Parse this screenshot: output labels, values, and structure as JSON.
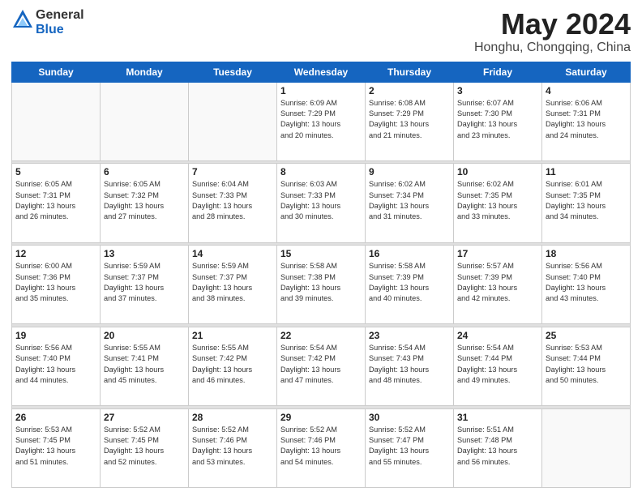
{
  "header": {
    "logo_general": "General",
    "logo_blue": "Blue",
    "title": "May 2024",
    "location": "Honghu, Chongqing, China"
  },
  "days_of_week": [
    "Sunday",
    "Monday",
    "Tuesday",
    "Wednesday",
    "Thursday",
    "Friday",
    "Saturday"
  ],
  "weeks": [
    [
      {
        "day": "",
        "info": ""
      },
      {
        "day": "",
        "info": ""
      },
      {
        "day": "",
        "info": ""
      },
      {
        "day": "1",
        "info": "Sunrise: 6:09 AM\nSunset: 7:29 PM\nDaylight: 13 hours\nand 20 minutes."
      },
      {
        "day": "2",
        "info": "Sunrise: 6:08 AM\nSunset: 7:29 PM\nDaylight: 13 hours\nand 21 minutes."
      },
      {
        "day": "3",
        "info": "Sunrise: 6:07 AM\nSunset: 7:30 PM\nDaylight: 13 hours\nand 23 minutes."
      },
      {
        "day": "4",
        "info": "Sunrise: 6:06 AM\nSunset: 7:31 PM\nDaylight: 13 hours\nand 24 minutes."
      }
    ],
    [
      {
        "day": "5",
        "info": "Sunrise: 6:05 AM\nSunset: 7:31 PM\nDaylight: 13 hours\nand 26 minutes."
      },
      {
        "day": "6",
        "info": "Sunrise: 6:05 AM\nSunset: 7:32 PM\nDaylight: 13 hours\nand 27 minutes."
      },
      {
        "day": "7",
        "info": "Sunrise: 6:04 AM\nSunset: 7:33 PM\nDaylight: 13 hours\nand 28 minutes."
      },
      {
        "day": "8",
        "info": "Sunrise: 6:03 AM\nSunset: 7:33 PM\nDaylight: 13 hours\nand 30 minutes."
      },
      {
        "day": "9",
        "info": "Sunrise: 6:02 AM\nSunset: 7:34 PM\nDaylight: 13 hours\nand 31 minutes."
      },
      {
        "day": "10",
        "info": "Sunrise: 6:02 AM\nSunset: 7:35 PM\nDaylight: 13 hours\nand 33 minutes."
      },
      {
        "day": "11",
        "info": "Sunrise: 6:01 AM\nSunset: 7:35 PM\nDaylight: 13 hours\nand 34 minutes."
      }
    ],
    [
      {
        "day": "12",
        "info": "Sunrise: 6:00 AM\nSunset: 7:36 PM\nDaylight: 13 hours\nand 35 minutes."
      },
      {
        "day": "13",
        "info": "Sunrise: 5:59 AM\nSunset: 7:37 PM\nDaylight: 13 hours\nand 37 minutes."
      },
      {
        "day": "14",
        "info": "Sunrise: 5:59 AM\nSunset: 7:37 PM\nDaylight: 13 hours\nand 38 minutes."
      },
      {
        "day": "15",
        "info": "Sunrise: 5:58 AM\nSunset: 7:38 PM\nDaylight: 13 hours\nand 39 minutes."
      },
      {
        "day": "16",
        "info": "Sunrise: 5:58 AM\nSunset: 7:39 PM\nDaylight: 13 hours\nand 40 minutes."
      },
      {
        "day": "17",
        "info": "Sunrise: 5:57 AM\nSunset: 7:39 PM\nDaylight: 13 hours\nand 42 minutes."
      },
      {
        "day": "18",
        "info": "Sunrise: 5:56 AM\nSunset: 7:40 PM\nDaylight: 13 hours\nand 43 minutes."
      }
    ],
    [
      {
        "day": "19",
        "info": "Sunrise: 5:56 AM\nSunset: 7:40 PM\nDaylight: 13 hours\nand 44 minutes."
      },
      {
        "day": "20",
        "info": "Sunrise: 5:55 AM\nSunset: 7:41 PM\nDaylight: 13 hours\nand 45 minutes."
      },
      {
        "day": "21",
        "info": "Sunrise: 5:55 AM\nSunset: 7:42 PM\nDaylight: 13 hours\nand 46 minutes."
      },
      {
        "day": "22",
        "info": "Sunrise: 5:54 AM\nSunset: 7:42 PM\nDaylight: 13 hours\nand 47 minutes."
      },
      {
        "day": "23",
        "info": "Sunrise: 5:54 AM\nSunset: 7:43 PM\nDaylight: 13 hours\nand 48 minutes."
      },
      {
        "day": "24",
        "info": "Sunrise: 5:54 AM\nSunset: 7:44 PM\nDaylight: 13 hours\nand 49 minutes."
      },
      {
        "day": "25",
        "info": "Sunrise: 5:53 AM\nSunset: 7:44 PM\nDaylight: 13 hours\nand 50 minutes."
      }
    ],
    [
      {
        "day": "26",
        "info": "Sunrise: 5:53 AM\nSunset: 7:45 PM\nDaylight: 13 hours\nand 51 minutes."
      },
      {
        "day": "27",
        "info": "Sunrise: 5:52 AM\nSunset: 7:45 PM\nDaylight: 13 hours\nand 52 minutes."
      },
      {
        "day": "28",
        "info": "Sunrise: 5:52 AM\nSunset: 7:46 PM\nDaylight: 13 hours\nand 53 minutes."
      },
      {
        "day": "29",
        "info": "Sunrise: 5:52 AM\nSunset: 7:46 PM\nDaylight: 13 hours\nand 54 minutes."
      },
      {
        "day": "30",
        "info": "Sunrise: 5:52 AM\nSunset: 7:47 PM\nDaylight: 13 hours\nand 55 minutes."
      },
      {
        "day": "31",
        "info": "Sunrise: 5:51 AM\nSunset: 7:48 PM\nDaylight: 13 hours\nand 56 minutes."
      },
      {
        "day": "",
        "info": ""
      }
    ]
  ]
}
